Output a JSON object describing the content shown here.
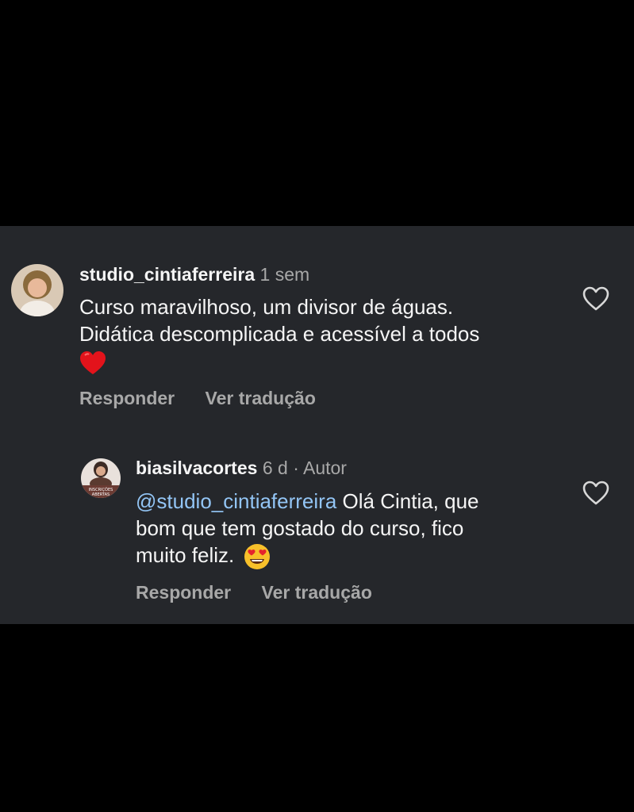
{
  "comments": [
    {
      "username": "studio_cintiaferreira",
      "time": "1 sem",
      "text_line1": "Curso maravilhoso,  um divisor de águas.",
      "text_line2": "Didática descomplicada e acessível a todos",
      "emoji": "red-heart-emoji",
      "reply_label": "Responder",
      "translate_label": "Ver tradução"
    },
    {
      "username": "biasilvacortes",
      "time": "6 d",
      "separator": "·",
      "author_badge": "Autor",
      "mention": "@studio_cintiaferreira",
      "text_rest": " Olá Cintia, que",
      "text_line2": "bom que tem gostado do curso, fico",
      "text_line3": "muito feliz. ",
      "emoji": "heart-eyes-emoji",
      "avatar_text_1": "INSCRIÇÕES",
      "avatar_text_2": "ABERTAS",
      "reply_label": "Responder",
      "translate_label": "Ver tradução"
    }
  ],
  "colors": {
    "background": "#25272b",
    "mention": "#93c5f5",
    "secondary": "#a8a8a8"
  }
}
